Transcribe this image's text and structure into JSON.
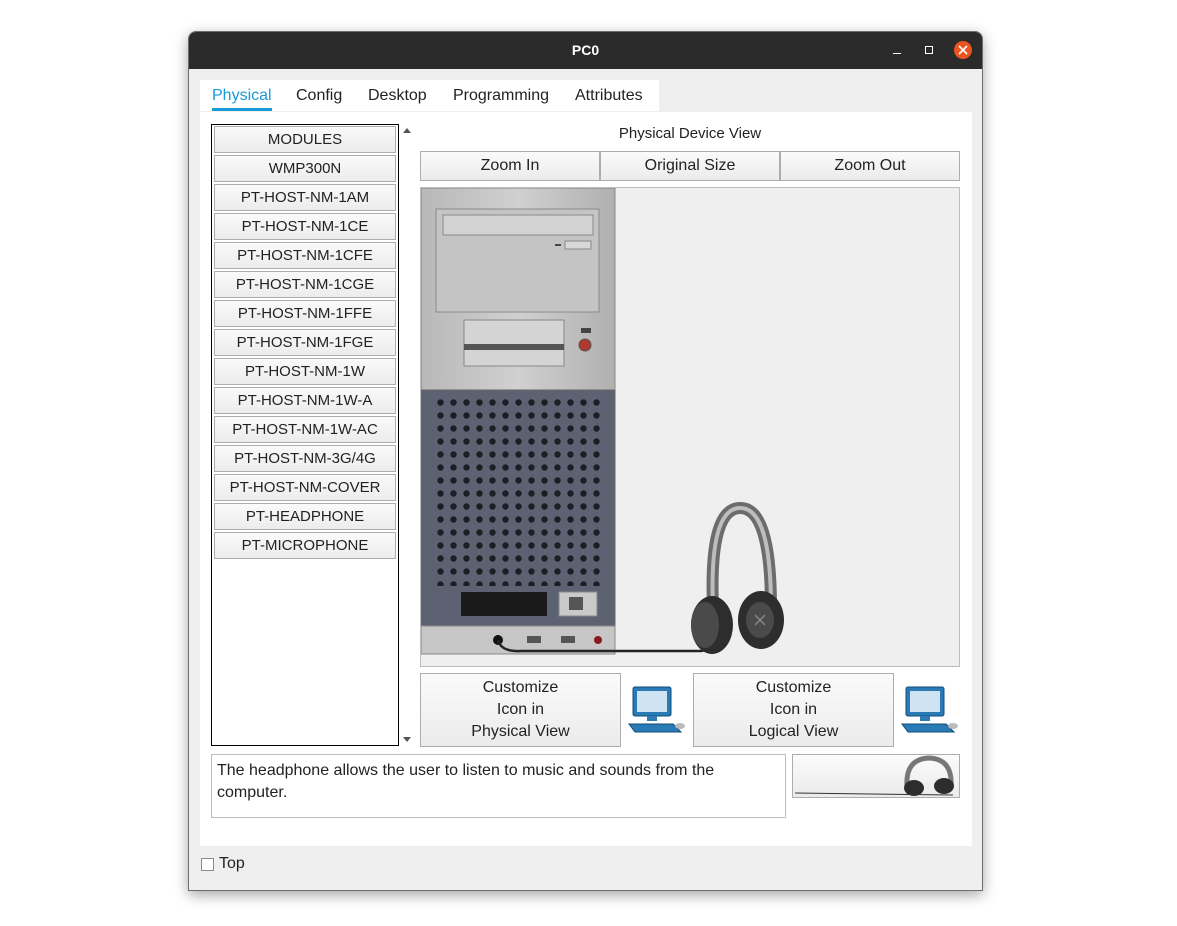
{
  "window": {
    "title": "PC0",
    "controls": {
      "minimize": "minimize-icon",
      "maximize": "maximize-icon",
      "close": "close-icon"
    },
    "close_color": "#e95420"
  },
  "tabs": [
    {
      "label": "Physical",
      "active": true
    },
    {
      "label": "Config",
      "active": false
    },
    {
      "label": "Desktop",
      "active": false
    },
    {
      "label": "Programming",
      "active": false
    },
    {
      "label": "Attributes",
      "active": false
    }
  ],
  "modules": [
    "MODULES",
    "WMP300N",
    "PT-HOST-NM-1AM",
    "PT-HOST-NM-1CE",
    "PT-HOST-NM-1CFE",
    "PT-HOST-NM-1CGE",
    "PT-HOST-NM-1FFE",
    "PT-HOST-NM-1FGE",
    "PT-HOST-NM-1W",
    "PT-HOST-NM-1W-A",
    "PT-HOST-NM-1W-AC",
    "PT-HOST-NM-3G/4G",
    "PT-HOST-NM-COVER",
    "PT-HEADPHONE",
    "PT-MICROPHONE"
  ],
  "physical_view": {
    "title": "Physical Device View",
    "zoom_in": "Zoom In",
    "original_size": "Original Size",
    "zoom_out": "Zoom Out"
  },
  "customize": {
    "physical": [
      "Customize",
      "Icon in",
      "Physical View"
    ],
    "logical": [
      "Customize",
      "Icon in",
      "Logical View"
    ]
  },
  "description": "The headphone allows the user to listen to music and sounds from the computer.",
  "top_checkbox": {
    "label": "Top",
    "checked": false
  },
  "accent_color": "#1a9ad6"
}
